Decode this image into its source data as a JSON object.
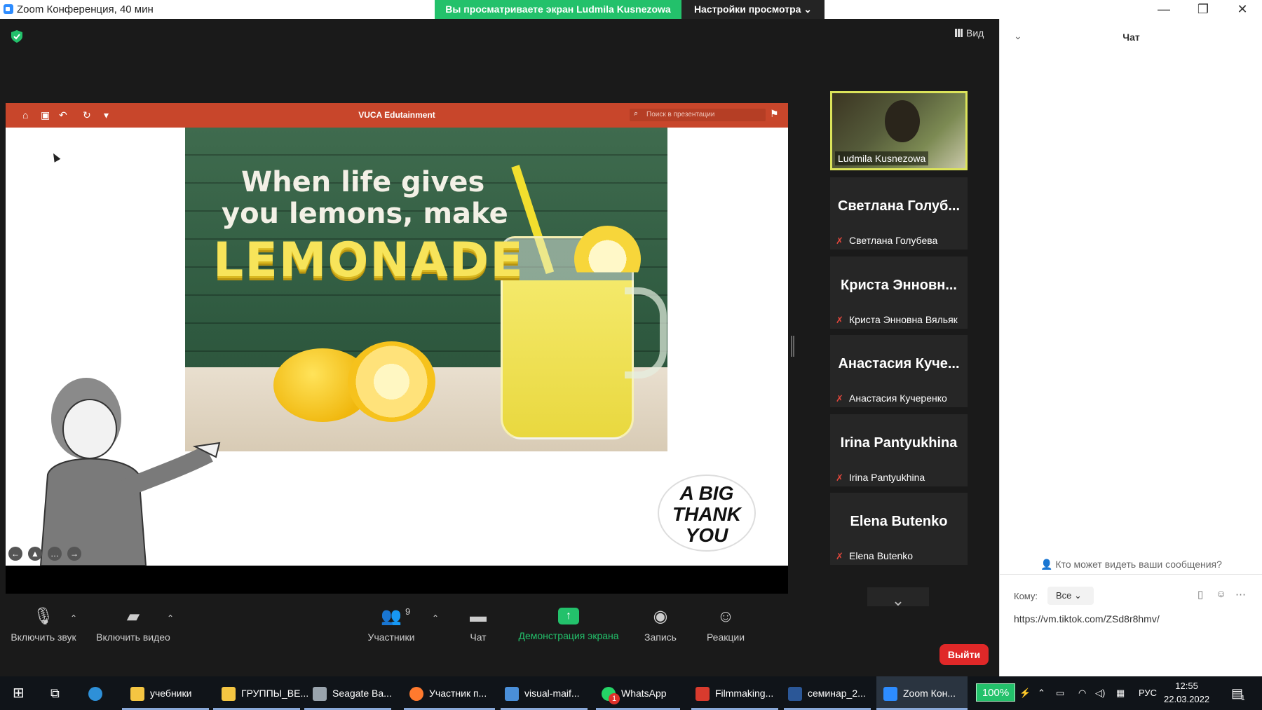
{
  "window": {
    "title": "Zoom Конференция, 40 мин",
    "minimize_glyph": "—",
    "restore_glyph": "❐",
    "close_glyph": "✕"
  },
  "share_banner": {
    "viewing_text": "Вы просматриваете экран Ludmila Kusnezowa",
    "view_options": "Настройки просмотра ⌄"
  },
  "stage": {
    "view_label": "Вид"
  },
  "presentation": {
    "doc_title": "VUCA Edutainment",
    "search_placeholder": "Поиск в презентации",
    "toolbar_icons": [
      "home-icon",
      "save-icon",
      "undo-icon",
      "redo-icon",
      "more-icon"
    ],
    "slide": {
      "heading_line1": "When life gives",
      "heading_line2": "you lemons, make",
      "heading_big": "LEMONADE",
      "badge_line1": "A BIG",
      "badge_line2": "THANK",
      "badge_line3": "YOU"
    }
  },
  "participants": {
    "active_speaker": "Ludmila Kusnezowa",
    "tiles": [
      {
        "display": "Светлана Голуб...",
        "full": "Светлана Голубева"
      },
      {
        "display": "Криста Энновн...",
        "full": "Криста Энновна Вяльяк"
      },
      {
        "display": "Анастасия Куче...",
        "full": "Анастасия Кучеренко"
      },
      {
        "display": "Irina Pantyukhina",
        "full": "Irina Pantyukhina"
      },
      {
        "display": "Elena Butenko",
        "full": "Elena Butenko"
      }
    ]
  },
  "controls": {
    "mute": "Включить звук",
    "video": "Включить видео",
    "participants": "Участники",
    "participants_count": "9",
    "chat": "Чат",
    "share": "Демонстрация экрана",
    "record": "Запись",
    "reactions": "Реакции",
    "leave": "Выйти"
  },
  "chat": {
    "title": "Чат",
    "who_can_see": "Кто может видеть ваши сообщения?",
    "to_label": "Кому:",
    "to_value": "Все",
    "message": "https://vm.tiktok.com/ZSd8r8hmv/"
  },
  "taskbar": {
    "items": [
      {
        "label": "учебники",
        "color": "#f4c542"
      },
      {
        "label": "ГРУППЫ_ВЕ...",
        "color": "#f4c542"
      },
      {
        "label": "Seagate Ba...",
        "color": "#9aa4ad"
      },
      {
        "label": "Участник п...",
        "color": "#ff7a2e"
      },
      {
        "label": "visual-maif...",
        "color": "#4a8fd8"
      },
      {
        "label": "WhatsApp",
        "color": "#25d366"
      },
      {
        "label": "Filmmaking...",
        "color": "#d83b2e"
      },
      {
        "label": "семинар_2...",
        "color": "#2b5797"
      },
      {
        "label": "Zoom Кон...",
        "color": "#2d8cff"
      }
    ],
    "whatsapp_badge": "1",
    "zoom_level": "100%",
    "language": "РУС",
    "time": "12:55",
    "date": "22.03.2022",
    "notifications": "1"
  }
}
